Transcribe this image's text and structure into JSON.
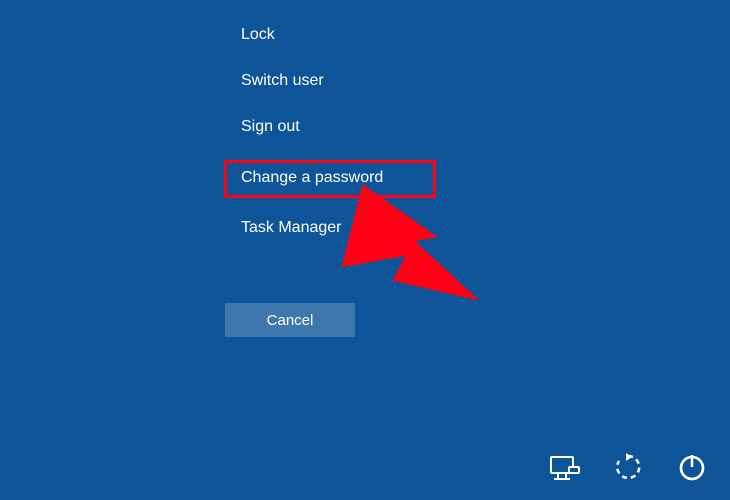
{
  "menu": {
    "items": [
      {
        "label": "Lock"
      },
      {
        "label": "Switch user"
      },
      {
        "label": "Sign out"
      },
      {
        "label": "Change a password"
      },
      {
        "label": "Task Manager"
      }
    ],
    "cancel_label": "Cancel"
  },
  "highlighted_index": 3,
  "icons": {
    "ease_of_access": "ease-of-access-icon",
    "network": "network-icon",
    "power": "power-icon"
  }
}
